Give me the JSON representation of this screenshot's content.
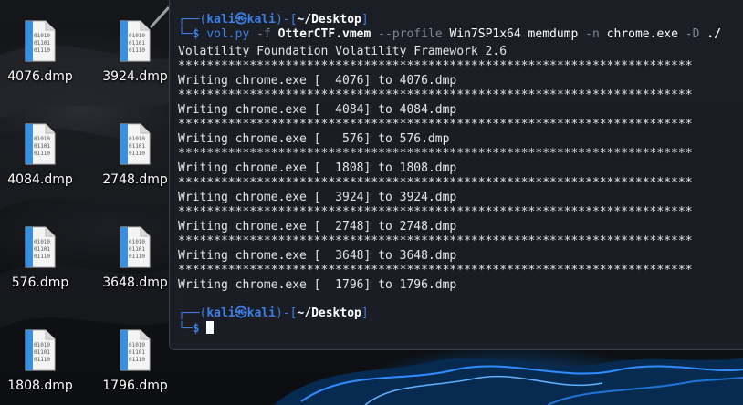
{
  "desktop": {
    "icons": [
      {
        "label": "4076.dmp"
      },
      {
        "label": "3924.dmp"
      },
      {
        "label": "4084.dmp"
      },
      {
        "label": "2748.dmp"
      },
      {
        "label": "576.dmp"
      },
      {
        "label": "3648.dmp"
      },
      {
        "label": "1808.dmp"
      },
      {
        "label": "1796.dmp"
      }
    ],
    "file_icon": "binary-file-icon"
  },
  "terminal": {
    "prompt1": {
      "open": "┌──(",
      "user": "kali㉿kali",
      "mid": ")-[",
      "path": "~/Desktop",
      "close": "]"
    },
    "command": {
      "corner": "└─",
      "dollar": "$ ",
      "program": "vol.py",
      "flag_f": " -f ",
      "file": "OtterCTF.vmem",
      "flag_profile": " --profile ",
      "profile": "Win7SP1x64",
      "plugin": " memdump ",
      "flag_n": "-n ",
      "process": "chrome.exe",
      "flag_d": " -D ",
      "dir": "./"
    },
    "output": [
      "Volatility Foundation Volatility Framework 2.6",
      "************************************************************************",
      "Writing chrome.exe [  4076] to 4076.dmp",
      "************************************************************************",
      "Writing chrome.exe [  4084] to 4084.dmp",
      "************************************************************************",
      "Writing chrome.exe [   576] to 576.dmp",
      "************************************************************************",
      "Writing chrome.exe [  1808] to 1808.dmp",
      "************************************************************************",
      "Writing chrome.exe [  3924] to 3924.dmp",
      "************************************************************************",
      "Writing chrome.exe [  2748] to 2748.dmp",
      "************************************************************************",
      "Writing chrome.exe [  3648] to 3648.dmp",
      "************************************************************************",
      "Writing chrome.exe [  1796] to 1796.dmp"
    ],
    "prompt2": {
      "open": "┌──(",
      "user": "kali㉿kali",
      "mid": ")-[",
      "path": "~/Desktop",
      "close": "]"
    },
    "prompt2_cmd": {
      "corner": "└─",
      "dollar": "$ "
    },
    "colors": {
      "prompt_blue": "#3d7fe5",
      "background": "#1b1f25",
      "text": "#e6e6e6"
    }
  }
}
